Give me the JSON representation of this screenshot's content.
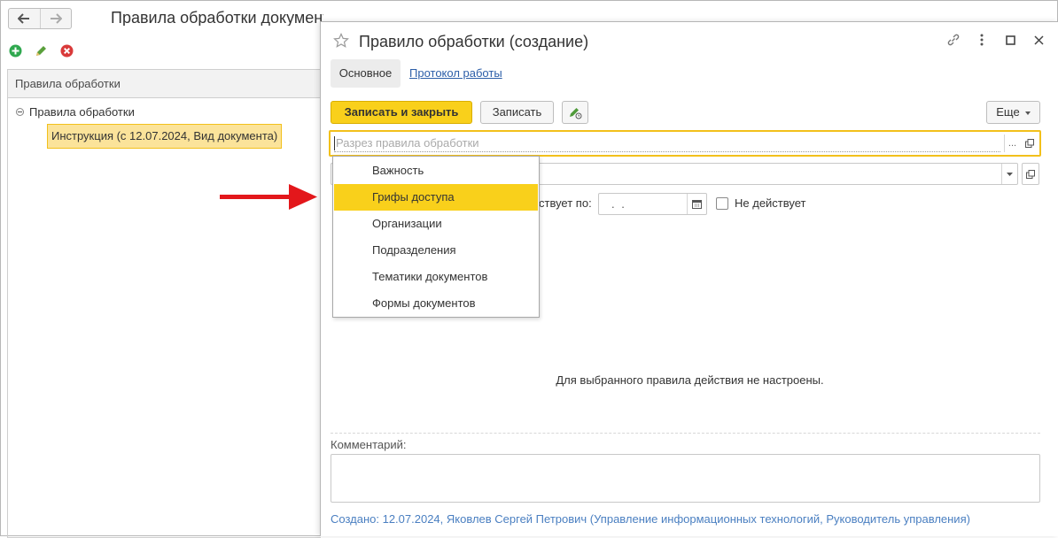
{
  "background_window": {
    "title": "Правила обработки документов (Инструкция)",
    "list_header": "Правила обработки",
    "tree_root": "Правила обработки",
    "tree_selected_item": "Инструкция (с 12.07.2024, Вид документа)",
    "toolbar_icons": [
      "add-icon",
      "edit-pencil-icon",
      "delete-icon"
    ]
  },
  "modal": {
    "title": "Правило обработки (создание)",
    "tabs": [
      {
        "label": "Основное",
        "active": true
      },
      {
        "label": "Протокол работы",
        "active": false
      }
    ],
    "toolbar": {
      "save_close_label": "Записать и закрыть",
      "save_label": "Записать",
      "more_label": "Еще"
    },
    "section_field": {
      "placeholder": "Разрез правила обработки"
    },
    "until_label": "ствует по:",
    "date_value": ". .",
    "inactive_label": "Не действует",
    "dropdown_options": [
      "Важность",
      "Грифы доступа",
      "Организации",
      "Подразделения",
      "Тематики документов",
      "Формы документов"
    ],
    "dropdown_selected": "Грифы доступа",
    "empty_message": "Для выбранного правила действия не настроены.",
    "comment_label": "Комментарий:",
    "comment_value": "",
    "created_text": "Создано: 12.07.2024, Яковлев Сергей Петрович (Управление информационных технологий, Руководитель управления)"
  },
  "colors": {
    "accent_yellow": "#f9d01b",
    "selection_bg": "#fbe39a",
    "link": "#2c5ea8",
    "arrow": "#e3171b"
  }
}
